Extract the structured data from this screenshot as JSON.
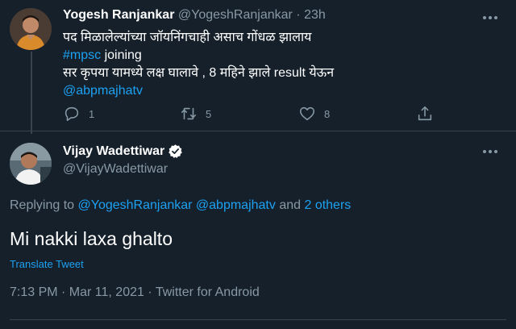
{
  "colors": {
    "background": "#15202b",
    "text_primary": "#ffffff",
    "text_muted": "#8899a6",
    "link": "#1da1f2",
    "divider": "#38444d",
    "verified": "#ffffff"
  },
  "parent_tweet": {
    "avatar_icon": "user-avatar",
    "name": "Yogesh Ranjankar",
    "handle": "@YogeshRanjankar",
    "separator": "·",
    "time": "23h",
    "more_icon": "more-horizontal-icon",
    "lines": [
      "पद मिळालेल्यांच्या जॉयनिंगचाही असाच गोंधळ झालाय",
      "सर कृपया यामध्ये लक्ष घालावे , 8 महिने झाले result येऊन"
    ],
    "hashtag": "#mpsc",
    "hashtag_suffix": " joining",
    "mention": "@abpmajhatv",
    "actions": {
      "reply": {
        "icon": "reply-icon",
        "count": "1"
      },
      "retweet": {
        "icon": "retweet-icon",
        "count": "5"
      },
      "like": {
        "icon": "heart-icon",
        "count": "8"
      },
      "share": {
        "icon": "share-icon",
        "count": ""
      }
    }
  },
  "main_tweet": {
    "avatar_icon": "user-avatar",
    "name": "Vijay Wadettiwar",
    "verified_icon": "verified-badge-icon",
    "handle": "@VijayWadettiwar",
    "more_icon": "more-horizontal-icon",
    "replying_prefix": "Replying to ",
    "replying_mentions": "@YogeshRanjankar @abpmajhatv",
    "replying_joiner": " and ",
    "replying_others": "2 others",
    "text": "Mi nakki laxa ghalto",
    "translate_label": "Translate Tweet",
    "timestamp": "7:13 PM · Mar 11, 2021 · Twitter for Android"
  }
}
